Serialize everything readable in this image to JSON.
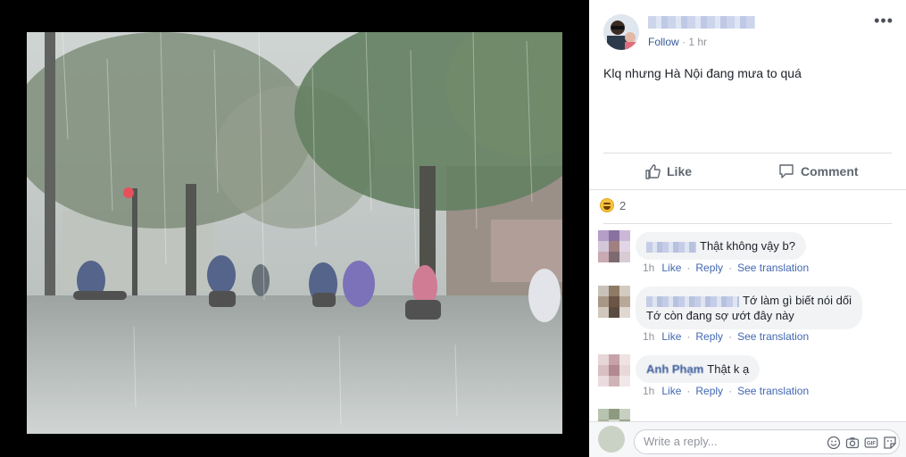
{
  "post": {
    "follow_label": "Follow",
    "time": "1 hr",
    "more_label": "•••",
    "text": "Klq nhưng Hà Nội đang mưa to quá"
  },
  "actions": {
    "like_label": "Like",
    "comment_label": "Comment"
  },
  "reactions": {
    "type_icon": "haha-emoji-icon",
    "count": "2"
  },
  "comments": [
    {
      "name": "",
      "text": "Thật không vậy b?",
      "time": "1h",
      "like": "Like",
      "reply": "Reply",
      "translate": "See translation"
    },
    {
      "name": "",
      "text_line1": "Tớ làm gì biết nói dối",
      "text_line2": "Tớ còn đang sợ ướt đây này",
      "time": "1h",
      "like": "Like",
      "reply": "Reply",
      "translate": "See translation"
    },
    {
      "name": "Anh Phạm",
      "text": "Thật k ạ",
      "time": "1h",
      "like": "Like",
      "reply": "Reply",
      "translate": "See translation"
    }
  ],
  "reply_box": {
    "placeholder": "Write a reply..."
  },
  "colors": {
    "link": "#4267b2",
    "name": "#385898",
    "muted": "#90949c",
    "bubble": "#f2f3f5"
  }
}
